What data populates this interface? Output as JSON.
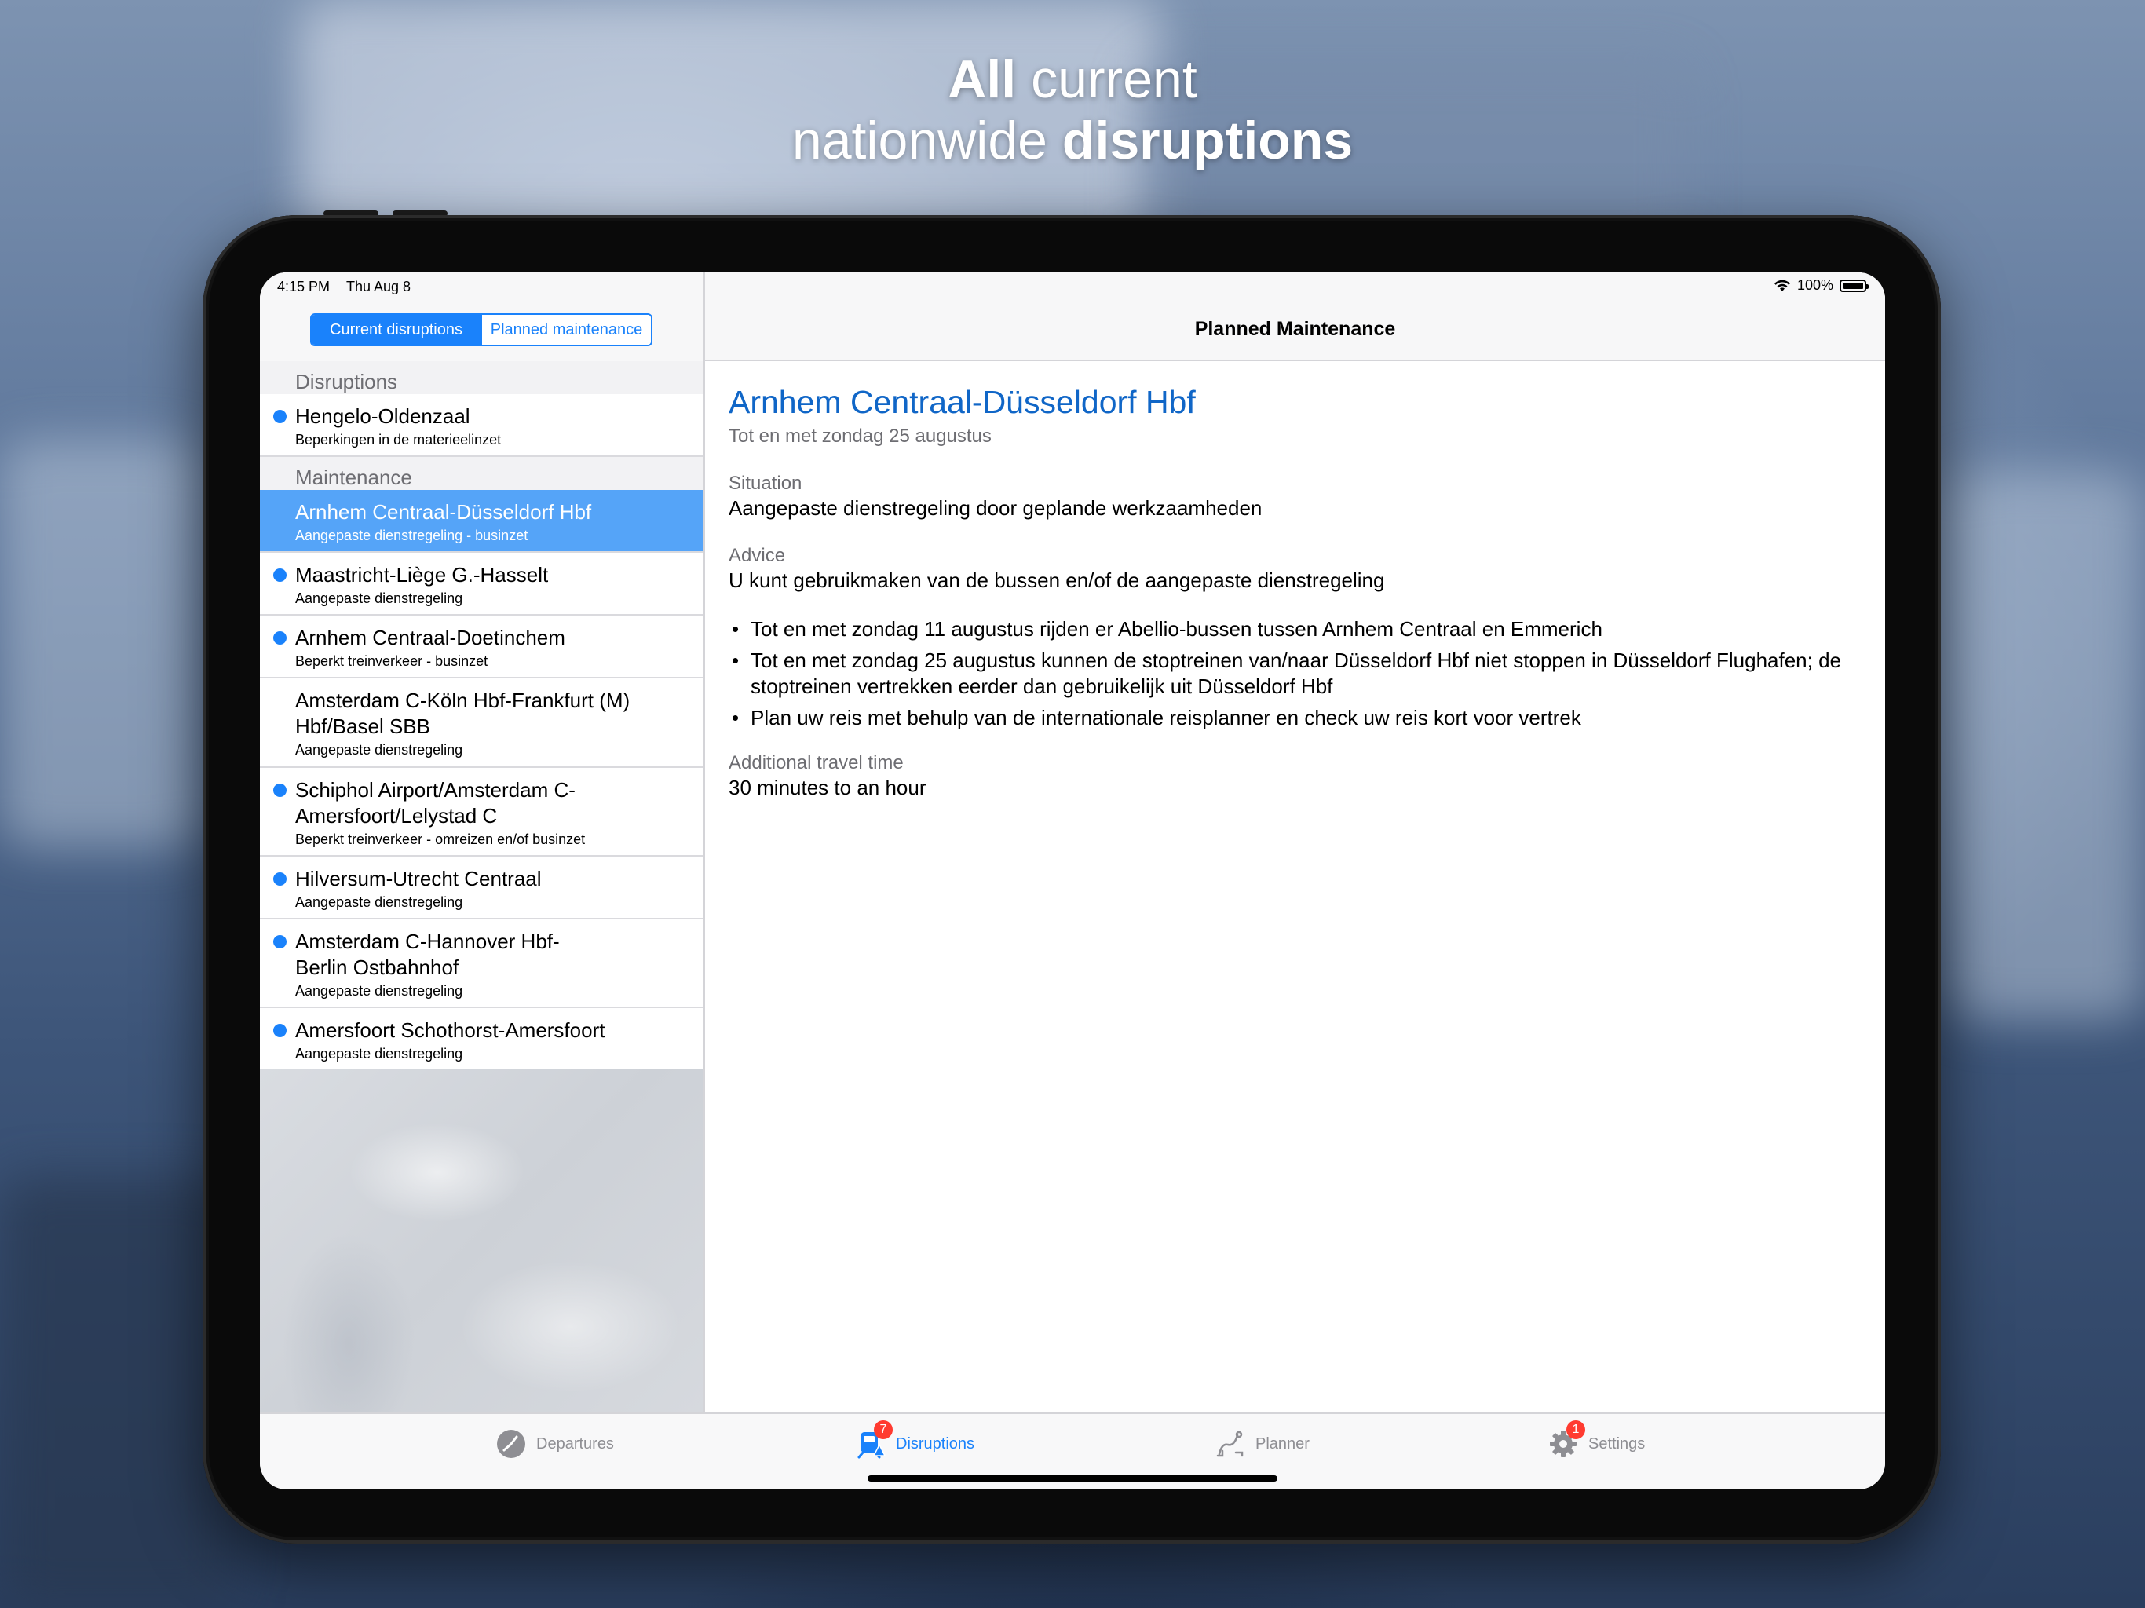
{
  "headline": {
    "line1_bold": "All",
    "line1_rest": " current",
    "line2_rest": "nationwide ",
    "line2_bold": "disruptions"
  },
  "status_bar": {
    "time": "4:15 PM",
    "date": "Thu Aug 8",
    "battery": "100%"
  },
  "segmented": {
    "current": "Current disruptions",
    "planned": "Planned maintenance"
  },
  "sidebar": {
    "section_disruptions": "Disruptions",
    "disruptions": [
      {
        "title": "Hengelo-Oldenzaal",
        "subtitle": "Beperkingen in de materieelinzet"
      }
    ],
    "section_maintenance": "Maintenance",
    "maintenance": [
      {
        "title": "Arnhem Centraal-Düsseldorf Hbf",
        "subtitle": "Aangepaste dienstregeling - businzet"
      },
      {
        "title": "Maastricht-Liège G.-Hasselt",
        "subtitle": "Aangepaste dienstregeling"
      },
      {
        "title": "Arnhem Centraal-Doetinchem",
        "subtitle": "Beperkt treinverkeer - businzet"
      },
      {
        "title": "Amsterdam C-Köln Hbf-Frankfurt (M) Hbf/Basel SBB",
        "subtitle": "Aangepaste dienstregeling"
      },
      {
        "title": "Schiphol Airport/Amsterdam C-Amersfoort/Lelystad C",
        "subtitle": "Beperkt treinverkeer - omreizen en/of businzet"
      },
      {
        "title": "Hilversum-Utrecht Centraal",
        "subtitle": "Aangepaste dienstregeling"
      },
      {
        "title": "Amsterdam C-Hannover Hbf-Berlin Ostbahnhof",
        "subtitle": "Aangepaste dienstregeling"
      },
      {
        "title": "Amersfoort Schothorst-Amersfoort",
        "subtitle": "Aangepaste dienstregeling"
      }
    ]
  },
  "detail": {
    "nav_title": "Planned Maintenance",
    "title": "Arnhem Centraal-Düsseldorf Hbf",
    "period": "Tot en met zondag 25 augustus",
    "situation_label": "Situation",
    "situation": "Aangepaste dienstregeling door geplande werkzaamheden",
    "advice_label": "Advice",
    "advice": "U kunt gebruikmaken van de bussen en/of de aangepaste dienstregeling",
    "bullets": [
      "Tot en met zondag 11 augustus rijden er Abellio-bussen tussen Arnhem Centraal en Emmerich",
      "Tot en met zondag 25 augustus kunnen de stoptreinen van/naar Düsseldorf Hbf niet stoppen in Düsseldorf Flughafen; de stoptreinen vertrekken eerder dan gebruikelijk uit Düsseldorf Hbf",
      "Plan uw reis met behulp van de internationale reisplanner en check uw reis kort voor vertrek"
    ],
    "extra_label": "Additional travel time",
    "extra": "30 minutes to an hour"
  },
  "tabs": {
    "departures": "Departures",
    "disruptions": "Disruptions",
    "disruptions_badge": "7",
    "planner": "Planner",
    "settings": "Settings",
    "settings_badge": "1"
  },
  "colors": {
    "accent": "#1a82fb",
    "selected_row": "#55a4f8",
    "title_blue": "#1066c7",
    "badge": "#ff3b30"
  }
}
